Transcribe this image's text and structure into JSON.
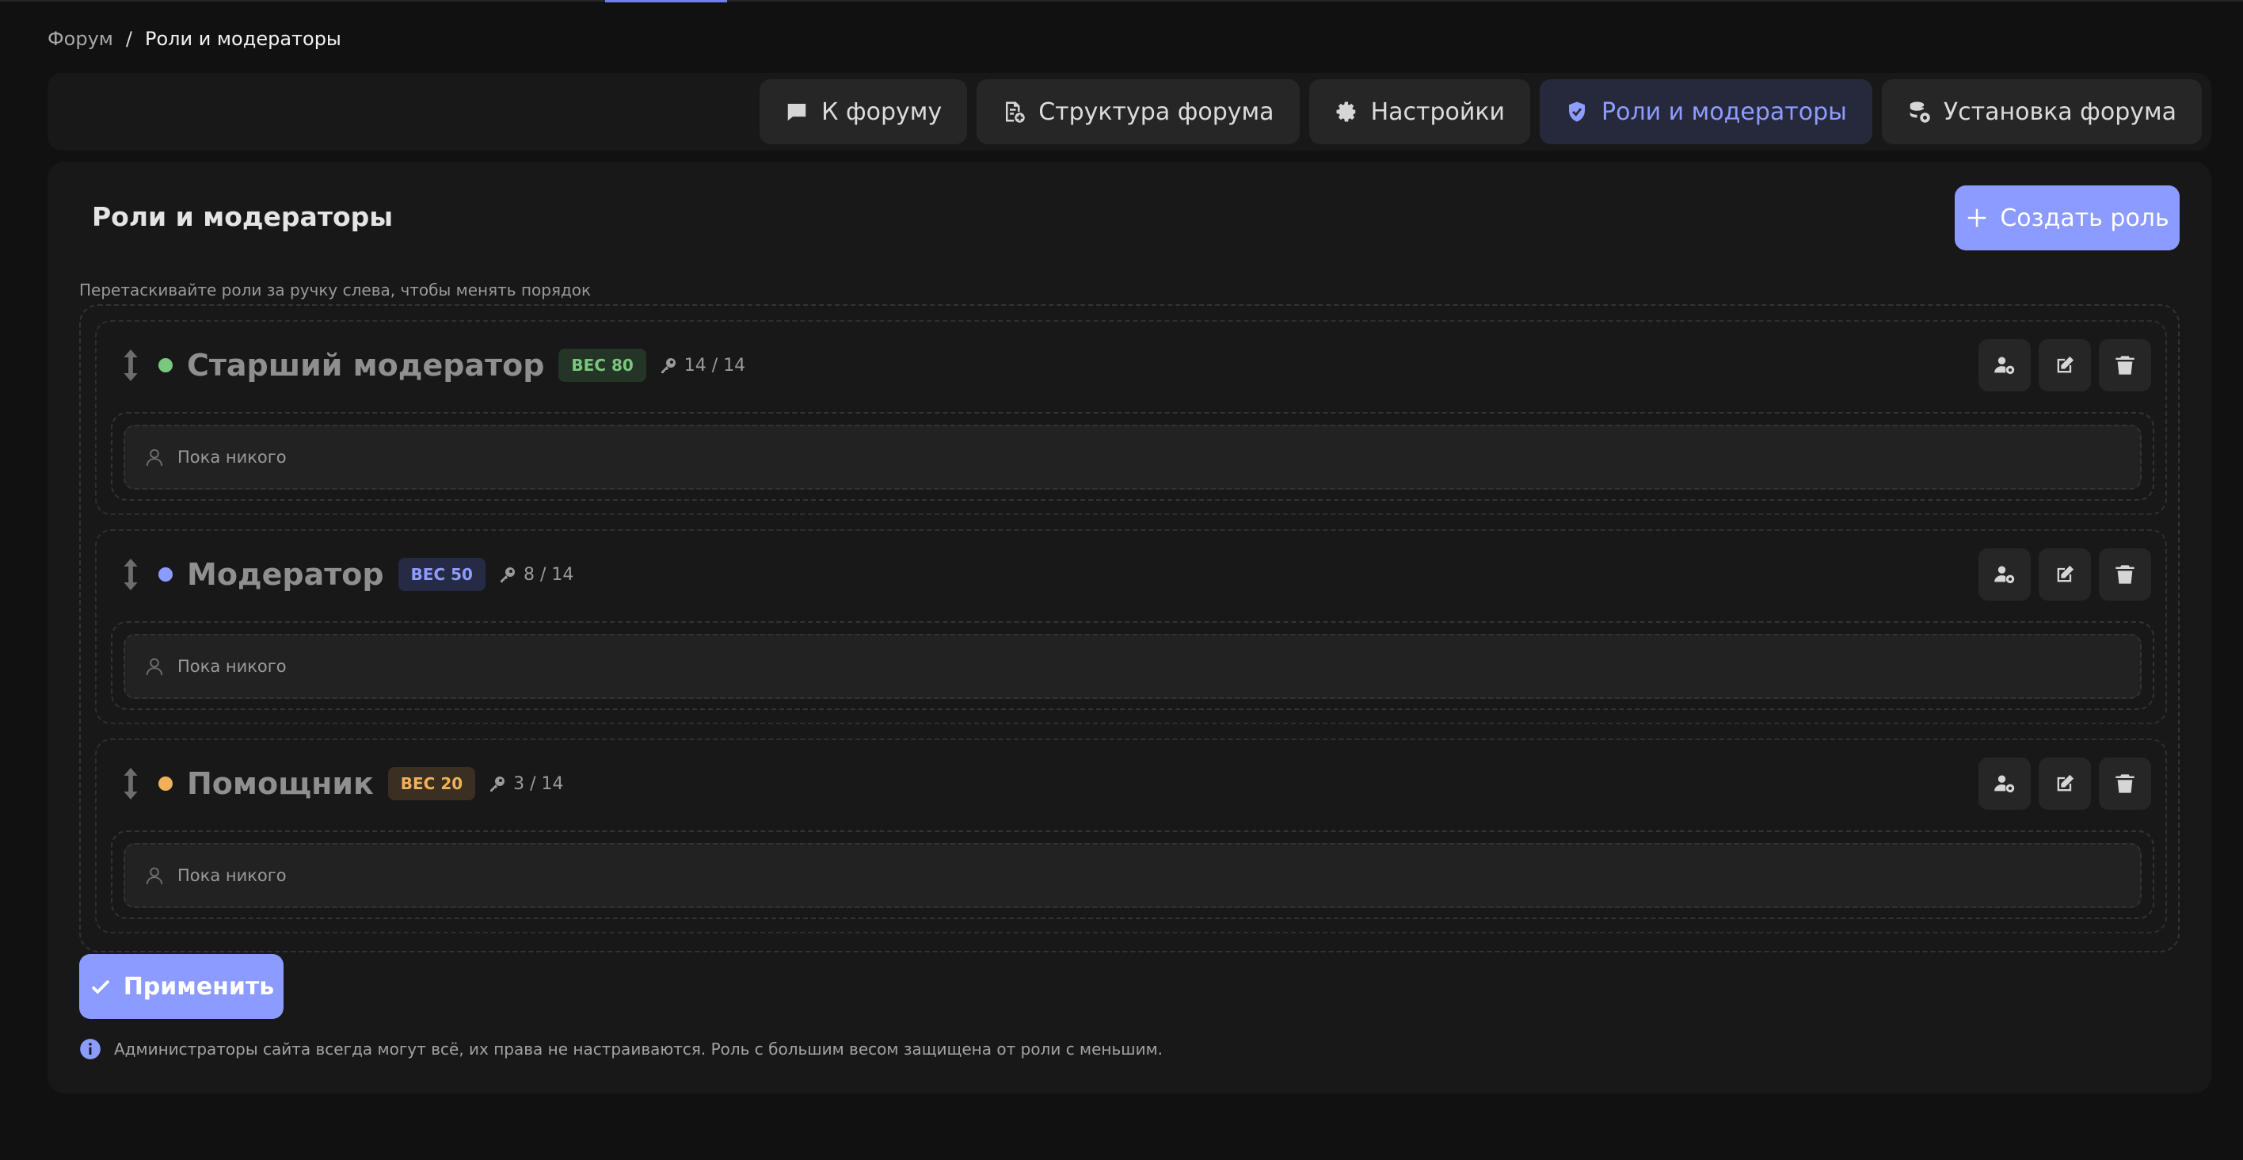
{
  "breadcrumb": {
    "root": "Форум",
    "separator": "/",
    "current": "Роли и модераторы"
  },
  "tabs": [
    {
      "label": "К форуму",
      "icon": "chat-icon",
      "active": false
    },
    {
      "label": "Структура форума",
      "icon": "structure-icon",
      "active": false
    },
    {
      "label": "Настройки",
      "icon": "gear-icon",
      "active": false
    },
    {
      "label": "Роли и модераторы",
      "icon": "shield-icon",
      "active": true
    },
    {
      "label": "Установка форума",
      "icon": "install-icon",
      "active": false
    }
  ],
  "main": {
    "title": "Роли и модераторы",
    "create_label": "Создать роль",
    "hint": "Перетаскивайте роли за ручку слева, чтобы менять порядок",
    "apply_label": "Применить",
    "footnote": "Администраторы сайта всегда могут всё, их права не настраиваются. Роль с большим весом защищена от роли с меньшим."
  },
  "roles": [
    {
      "name": "Старший модератор",
      "badge": "ВЕС 80",
      "permissions": "14 / 14",
      "empty_text": "Пока никого",
      "color": "#7ac77e",
      "badge_bg": "#243427",
      "badge_fg": "#7ac77e"
    },
    {
      "name": "Модератор",
      "badge": "ВЕС 50",
      "permissions": "8 / 14",
      "empty_text": "Пока никого",
      "color": "#8c9bff",
      "badge_bg": "#262b45",
      "badge_fg": "#8f9cff"
    },
    {
      "name": "Помощник",
      "badge": "ВЕС 20",
      "permissions": "3 / 14",
      "empty_text": "Пока никого",
      "color": "#f1b15b",
      "badge_bg": "#3a2f21",
      "badge_fg": "#f1b15b"
    }
  ],
  "colors": {
    "accent": "#8c9bff",
    "background": "#111111",
    "panel": "#181818"
  }
}
